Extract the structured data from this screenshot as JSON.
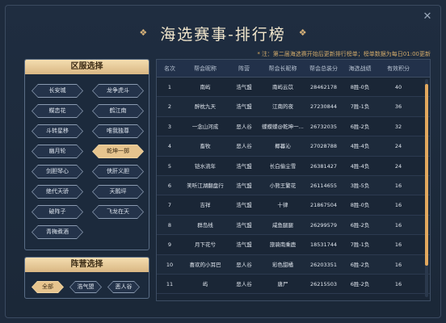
{
  "window": {
    "close_glyph": "✕",
    "title": "海选赛事-排行榜"
  },
  "notice": {
    "star": "*",
    "text": "注：第二届海选赛开始后更新排行榜单；榜单数据为每日01:00更新"
  },
  "server_panel": {
    "title": "区服选择",
    "servers": [
      {
        "label": "长安城",
        "active": false
      },
      {
        "label": "龙争虎斗",
        "active": false
      },
      {
        "label": "蝶恋花",
        "active": false
      },
      {
        "label": "鹤江南",
        "active": false
      },
      {
        "label": "斗转星移",
        "active": false
      },
      {
        "label": "唯我独尊",
        "active": false
      },
      {
        "label": "幽月轮",
        "active": false
      },
      {
        "label": "乾坤一掷",
        "active": true
      },
      {
        "label": "剑胆琴心",
        "active": false
      },
      {
        "label": "侠肝义胆",
        "active": false
      },
      {
        "label": "绝代天骄",
        "active": false
      },
      {
        "label": "天鹅坪",
        "active": false
      },
      {
        "label": "破阵子",
        "active": false
      },
      {
        "label": "飞龙在天",
        "active": false
      },
      {
        "label": "青梅煮酒",
        "active": false
      }
    ]
  },
  "camp_panel": {
    "title": "阵营选择",
    "camps": [
      {
        "label": "全部",
        "active": true
      },
      {
        "label": "浩气盟",
        "active": false
      },
      {
        "label": "恶人谷",
        "active": false
      }
    ]
  },
  "table": {
    "headers": [
      "名次",
      "帮会昵称",
      "阵营",
      "帮会长昵称",
      "帮会总装分",
      "海选战绩",
      "有效积分"
    ],
    "rows": [
      [
        "1",
        "南屿",
        "浩气盟",
        "南屿云苡",
        "28462178",
        "8胜-0负",
        "40"
      ],
      [
        "2",
        "醉枕九天",
        "浩气盟",
        "江南的夜",
        "27230844",
        "7胜-1负",
        "36"
      ],
      [
        "3",
        "一念山河成",
        "恶人谷",
        "蝶蝶蝶@乾坤一...",
        "26732035",
        "6胜-2负",
        "32"
      ],
      [
        "4",
        "畜牧",
        "恶人谷",
        "椰暮沁",
        "27028788",
        "4胜-4负",
        "24"
      ],
      [
        "5",
        "铠水流年",
        "浩气盟",
        "长白偷尘雪",
        "26381427",
        "4胜-4负",
        "24"
      ],
      [
        "6",
        "笑听江湖翻盘行",
        "浩气盟",
        "小熊王繁花",
        "26114655",
        "3胜-5负",
        "16"
      ],
      [
        "7",
        "吉祥",
        "浩气盟",
        "十律",
        "21867504",
        "8胜-0负",
        "16"
      ],
      [
        "8",
        "群岛线",
        "浩气盟",
        "咸鱼腿腿",
        "26299579",
        "6胜-2负",
        "16"
      ],
      [
        "9",
        "月下花兮",
        "浩气盟",
        "旅骑南乘鹿",
        "18531744",
        "7胜-1负",
        "16"
      ],
      [
        "10",
        "喜欢的小耳巴",
        "恶人谷",
        "彩色甜橘",
        "26203351",
        "6胜-2负",
        "16"
      ],
      [
        "11",
        "屿",
        "恶人谷",
        "唐尸",
        "26215503",
        "6胜-2负",
        "16"
      ]
    ]
  }
}
